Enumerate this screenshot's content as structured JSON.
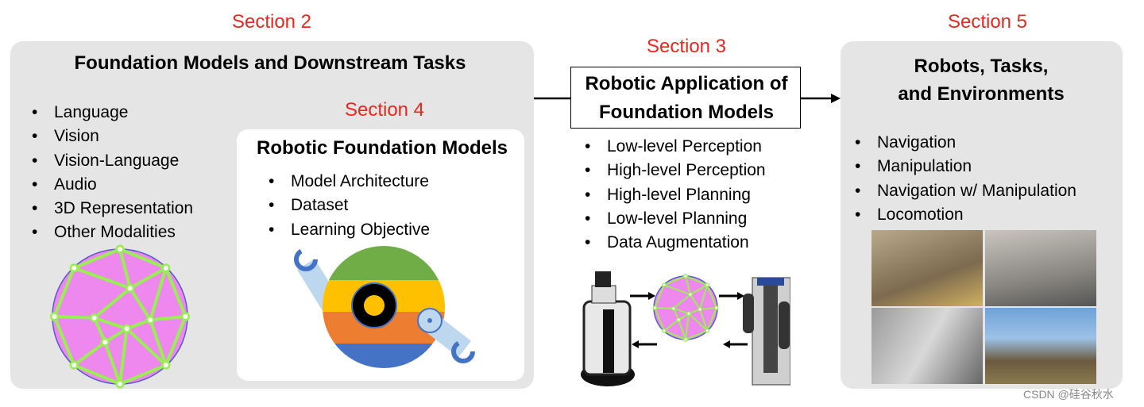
{
  "section2": {
    "label": "Section 2",
    "title": "Foundation Models and Downstream Tasks",
    "items": [
      "Language",
      "Vision",
      "Vision-Language",
      "Audio",
      "3D Representation",
      "Other Modalities"
    ]
  },
  "section4": {
    "label": "Section 4",
    "title": "Robotic Foundation Models",
    "items": [
      "Model Architecture",
      "Dataset",
      "Learning Objective"
    ]
  },
  "section3": {
    "label": "Section 3",
    "title_line1": "Robotic Application of",
    "title_line2": "Foundation Models",
    "items": [
      "Low-level Perception",
      "High-level Perception",
      "High-level Planning",
      "Low-level Planning",
      "Data Augmentation"
    ]
  },
  "section5": {
    "label": "Section 5",
    "title_line1": "Robots, Tasks,",
    "title_line2": "and Environments",
    "items": [
      "Navigation",
      "Manipulation",
      "Navigation w/ Manipulation",
      "Locomotion"
    ]
  },
  "watermark": "CSDN @硅谷秋水",
  "colors": {
    "section_label": "#e8281f",
    "panel": "#e5e5e5",
    "network_fill": "#ee88ee",
    "network_edges": "#99ee55",
    "logo_green": "#70ad47",
    "logo_yellow": "#ffc000",
    "logo_orange": "#ed7d31",
    "logo_blue": "#4472c4"
  }
}
